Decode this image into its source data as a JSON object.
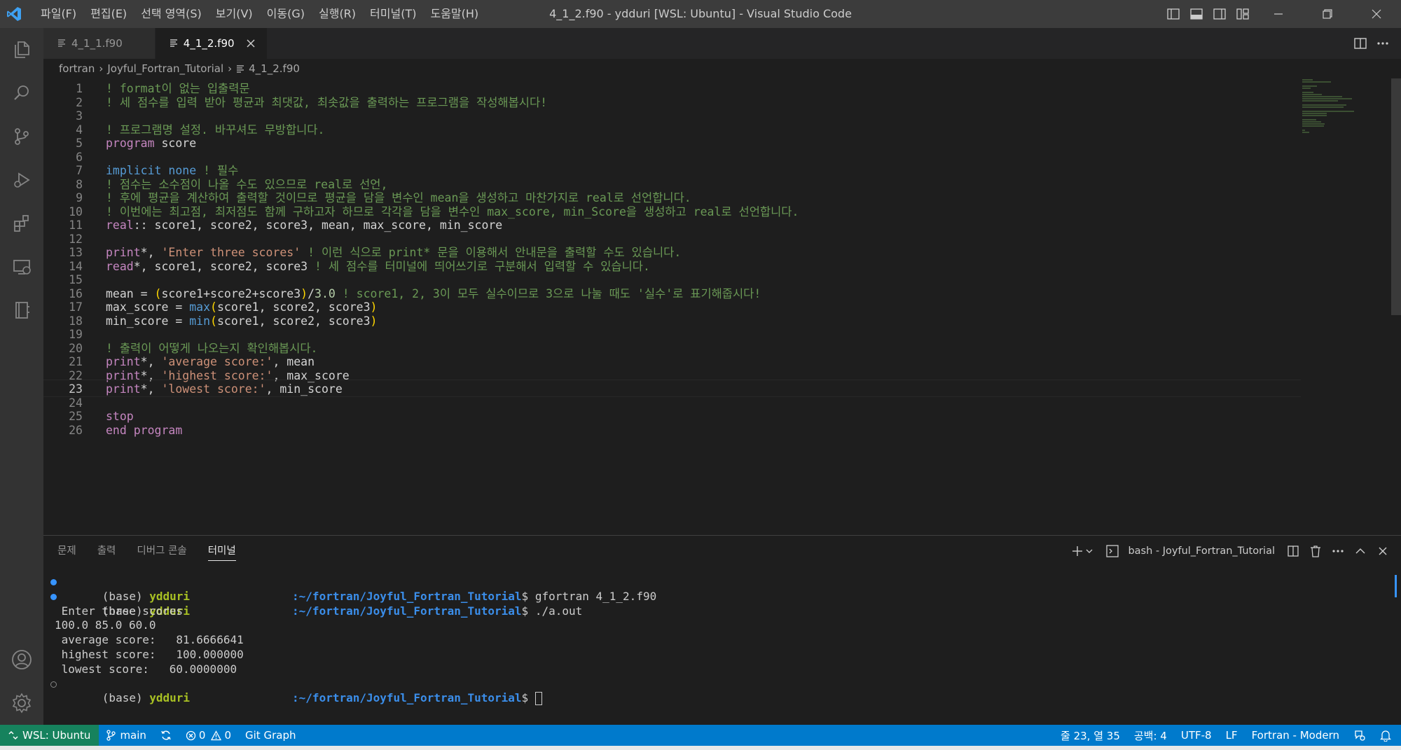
{
  "window": {
    "title": "4_1_2.f90 - ydduri [WSL: Ubuntu] - Visual Studio Code",
    "menu": [
      "파일(F)",
      "편집(E)",
      "선택 영역(S)",
      "보기(V)",
      "이동(G)",
      "실행(R)",
      "터미널(T)",
      "도움말(H)"
    ]
  },
  "tabs": [
    {
      "label": "4_1_1.f90",
      "active": false
    },
    {
      "label": "4_1_2.f90",
      "active": true
    }
  ],
  "breadcrumb": [
    "fortran",
    "Joyful_Fortran_Tutorial",
    "4_1_2.f90"
  ],
  "editor": {
    "current_line": 23,
    "lines": [
      {
        "n": "1",
        "tokens": [
          {
            "t": "! format이 없는 입출력문",
            "c": "com"
          }
        ]
      },
      {
        "n": "2",
        "tokens": [
          {
            "t": "! 세 점수를 입력 받아 평균과 최댓값, 최솟값을 출력하는 프로그램을 작성해봅시다!",
            "c": "com"
          }
        ]
      },
      {
        "n": "3",
        "tokens": []
      },
      {
        "n": "4",
        "tokens": [
          {
            "t": "! 프로그램명 설정. 바꾸셔도 무방합니다.",
            "c": "com"
          }
        ]
      },
      {
        "n": "5",
        "tokens": [
          {
            "t": "program",
            "c": "kw"
          },
          {
            "t": " score",
            "c": "id"
          }
        ]
      },
      {
        "n": "6",
        "tokens": []
      },
      {
        "n": "7",
        "tokens": [
          {
            "t": "implicit",
            "c": "kw2"
          },
          {
            "t": " ",
            "c": "id"
          },
          {
            "t": "none",
            "c": "kw2"
          },
          {
            "t": " ! 필수",
            "c": "com"
          }
        ]
      },
      {
        "n": "8",
        "tokens": [
          {
            "t": "! 점수는 소수점이 나올 수도 있으므로 real로 선언,",
            "c": "com"
          }
        ]
      },
      {
        "n": "9",
        "tokens": [
          {
            "t": "! 후에 평균을 계산하여 출력할 것이므로 평균을 담을 변수인 mean을 생성하고 마찬가지로 real로 선언합니다.",
            "c": "com"
          }
        ]
      },
      {
        "n": "10",
        "tokens": [
          {
            "t": "! 이번에는 최고점, 최저점도 함께 구하고자 하므로 각각을 담을 변수인 max_score, min_Score을 생성하고 real로 선언합니다.",
            "c": "com"
          }
        ]
      },
      {
        "n": "11",
        "tokens": [
          {
            "t": "real",
            "c": "kw"
          },
          {
            "t": ":: score1, score2, score3, mean, max_score, min_score",
            "c": "id"
          }
        ]
      },
      {
        "n": "12",
        "tokens": []
      },
      {
        "n": "13",
        "tokens": [
          {
            "t": "print",
            "c": "kw"
          },
          {
            "t": "*, ",
            "c": "id"
          },
          {
            "t": "'Enter three scores'",
            "c": "str"
          },
          {
            "t": " ! 이런 식으로 print* 문을 이용해서 안내문을 출력할 수도 있습니다.",
            "c": "com"
          }
        ]
      },
      {
        "n": "14",
        "tokens": [
          {
            "t": "read",
            "c": "kw"
          },
          {
            "t": "*, score1, score2, score3",
            "c": "id"
          },
          {
            "t": " ! 세 점수를 터미널에 띄어쓰기로 구분해서 입력할 수 있습니다.",
            "c": "com"
          }
        ]
      },
      {
        "n": "15",
        "tokens": []
      },
      {
        "n": "16",
        "tokens": [
          {
            "t": "mean = ",
            "c": "id"
          },
          {
            "t": "(",
            "c": "br"
          },
          {
            "t": "score1+score2+score3",
            "c": "id"
          },
          {
            "t": ")",
            "c": "br"
          },
          {
            "t": "/",
            "c": "id"
          },
          {
            "t": "3.0",
            "c": "num"
          },
          {
            "t": " ! score1, 2, 3이 모두 실수이므로 3으로 나눌 때도 '실수'로 표기해줍시다!",
            "c": "com"
          }
        ]
      },
      {
        "n": "17",
        "tokens": [
          {
            "t": "max_score = ",
            "c": "id"
          },
          {
            "t": "max",
            "c": "fn"
          },
          {
            "t": "(",
            "c": "br"
          },
          {
            "t": "score1, score2, score3",
            "c": "id"
          },
          {
            "t": ")",
            "c": "br"
          }
        ]
      },
      {
        "n": "18",
        "tokens": [
          {
            "t": "min_score = ",
            "c": "id"
          },
          {
            "t": "min",
            "c": "fn"
          },
          {
            "t": "(",
            "c": "br"
          },
          {
            "t": "score1, score2, score3",
            "c": "id"
          },
          {
            "t": ")",
            "c": "br"
          }
        ]
      },
      {
        "n": "19",
        "tokens": []
      },
      {
        "n": "20",
        "tokens": [
          {
            "t": "! 출력이 어떻게 나오는지 확인해봅시다.",
            "c": "com"
          }
        ]
      },
      {
        "n": "21",
        "tokens": [
          {
            "t": "print",
            "c": "kw"
          },
          {
            "t": "*, ",
            "c": "id"
          },
          {
            "t": "'average score:'",
            "c": "str"
          },
          {
            "t": ", mean",
            "c": "id"
          }
        ]
      },
      {
        "n": "22",
        "tokens": [
          {
            "t": "print",
            "c": "kw"
          },
          {
            "t": "*, ",
            "c": "id"
          },
          {
            "t": "'highest score:'",
            "c": "str"
          },
          {
            "t": ", max_score",
            "c": "id"
          }
        ]
      },
      {
        "n": "23",
        "tokens": [
          {
            "t": "print",
            "c": "kw"
          },
          {
            "t": "*, ",
            "c": "id"
          },
          {
            "t": "'lowest score:'",
            "c": "str"
          },
          {
            "t": ", min_score",
            "c": "id"
          }
        ]
      },
      {
        "n": "24",
        "tokens": []
      },
      {
        "n": "25",
        "tokens": [
          {
            "t": "stop",
            "c": "kw"
          }
        ]
      },
      {
        "n": "26",
        "tokens": [
          {
            "t": "end program",
            "c": "kw"
          }
        ]
      }
    ]
  },
  "panel": {
    "tabs": [
      {
        "label": "문제",
        "active": false
      },
      {
        "label": "출력",
        "active": false
      },
      {
        "label": "디버그 콘솔",
        "active": false
      },
      {
        "label": "터미널",
        "active": true
      }
    ],
    "terminal_name": "bash - Joyful_Fortran_Tutorial"
  },
  "terminal": {
    "prompt_prefix": "(base) ",
    "user": "ydduri",
    "path": ":~/fortran/Joyful_Fortran_Tutorial",
    "dollar": "$",
    "cmd1": " gfortran 4_1_2.f90",
    "cmd2": " ./a.out",
    "output": [
      " Enter three scores",
      "100.0 85.0 60.0",
      " average score:   81.6666641",
      " highest score:   100.000000",
      " lowest score:   60.0000000"
    ]
  },
  "statusbar": {
    "remote": "WSL: Ubuntu",
    "branch": "main",
    "errors": "0",
    "warnings": "0",
    "git_graph": "Git Graph",
    "position": "줄 23, 열 35",
    "spaces": "공백: 4",
    "encoding": "UTF-8",
    "eol": "LF",
    "language": "Fortran - Modern"
  },
  "colors": {
    "accent": "#007acc",
    "remote": "#16825d",
    "comment": "#6a9955",
    "keyword": "#c586c0",
    "string": "#ce9178"
  }
}
